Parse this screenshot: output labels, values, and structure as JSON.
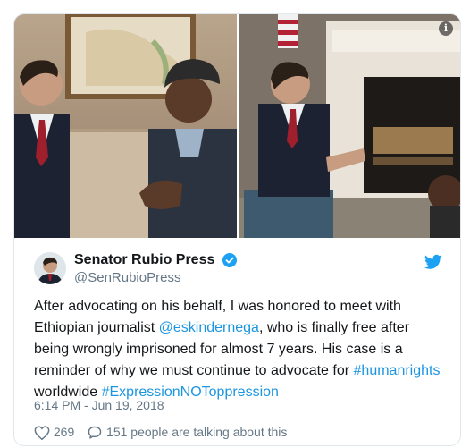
{
  "tweet": {
    "display_name": "Senator Rubio Press",
    "handle": "@SenRubioPress",
    "text_before": "After advocating on his behalf, I was honored to meet with Ethiopian journalist ",
    "mention": "@eskindernega",
    "text_middle": ", who is finally free after being wrongly imprisoned for almost 7 years. His case is a reminder of why we must continue to advocate for ",
    "hashtag1": "#humanrights",
    "text_after": " worldwide ",
    "hashtag2": "#ExpressionNOToppression",
    "timestamp": "6:14 PM - Jun 19, 2018",
    "likes": "269",
    "talking": "151 people are talking about this",
    "info_glyph": "i"
  },
  "icons": {
    "verified": "verified-badge-icon",
    "twitter": "twitter-bird-icon",
    "heart": "heart-icon",
    "reply": "reply-bubble-icon",
    "info": "info-icon"
  },
  "colors": {
    "link": "#1b95e0",
    "twitter_blue": "#1da1f2",
    "muted": "#657786",
    "text": "#14171a",
    "border": "#e1e8ed"
  }
}
